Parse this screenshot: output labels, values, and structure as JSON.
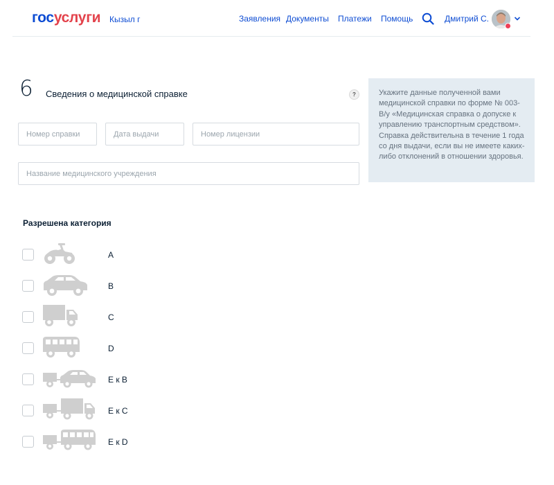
{
  "header": {
    "logo_gos": "гос",
    "logo_uslugi": "услуги",
    "city": "Кызыл г",
    "nav": [
      "Заявления",
      "Документы",
      "Платежи",
      "Помощь"
    ],
    "user_name": "Дмитрий С."
  },
  "section": {
    "step": "6",
    "title": "Сведения о медицинской справке",
    "help_label": "?",
    "hint": "Укажите данные полученной вами медицинской справки по форме № 003-В/у «Медицинская справка о допуске к управлению транспортным средством». Справка действительна в течение 1 года со дня выдачи, если вы не имеете каких-либо отклонений в отношении здоровья."
  },
  "fields": {
    "cert_number_placeholder": "Номер справки",
    "issue_date_placeholder": "Дата выдачи",
    "license_number_placeholder": "Номер лицензии",
    "institution_placeholder": "Название медицинского учреждения"
  },
  "categories": {
    "title": "Разрешена категория",
    "items": [
      {
        "label": "A",
        "icon": "motorcycle-icon",
        "checked": false
      },
      {
        "label": "B",
        "icon": "car-icon",
        "checked": false
      },
      {
        "label": "C",
        "icon": "truck-icon",
        "checked": false
      },
      {
        "label": "D",
        "icon": "bus-icon",
        "checked": false
      },
      {
        "label": "E к B",
        "icon": "car-trailer-icon",
        "checked": false
      },
      {
        "label": "E к C",
        "icon": "truck-trailer-icon",
        "checked": false
      },
      {
        "label": "E к D",
        "icon": "bus-trailer-icon",
        "checked": false
      }
    ]
  },
  "colors": {
    "brand_blue": "#0d4cd3",
    "brand_red": "#e3424b",
    "hint_bg": "#e4ecf2",
    "icon_gray": "#cfcfcf"
  }
}
